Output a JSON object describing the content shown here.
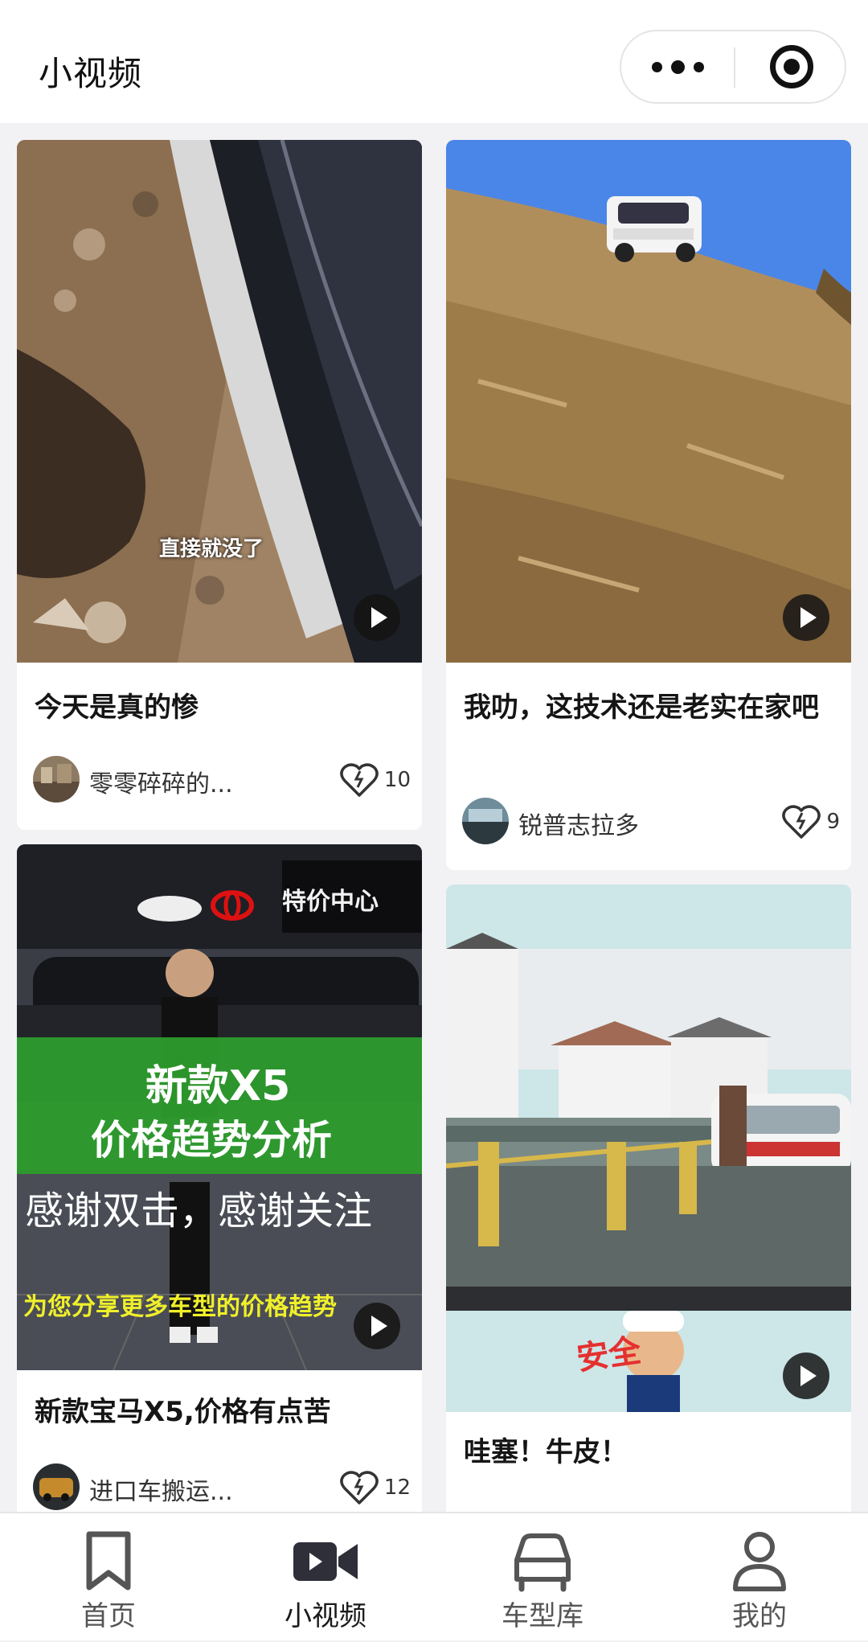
{
  "header": {
    "title": "小视频"
  },
  "colors": {
    "accent": "#2f2f3a",
    "inactive": "#555555"
  },
  "feed": [
    {
      "title": "今天是真的惨",
      "author": "零零碎碎的...",
      "likes": "10",
      "overlay_caption": "直接就没了"
    },
    {
      "title": "我叻，这技术还是老实在家吧",
      "author": "锐普志拉多",
      "likes": "9"
    },
    {
      "title": "新款宝马X5,价格有点苦",
      "author": "进口车搬运...",
      "likes": "12",
      "overlay_sign": "特价中心",
      "overlay_banner_line1": "新款X5",
      "overlay_banner_line2": "价格趋势分析",
      "overlay_line3": "感谢双击，感谢关注",
      "overlay_line4": "为您分享更多车型的价格趋势"
    },
    {
      "title": "哇塞！牛皮！",
      "overlay_sticker": "安全"
    }
  ],
  "tabbar": [
    {
      "label": "首页",
      "icon": "bookmark-icon"
    },
    {
      "label": "小视频",
      "icon": "video-camera-icon",
      "active": true
    },
    {
      "label": "车型库",
      "icon": "car-icon"
    },
    {
      "label": "我的",
      "icon": "user-icon"
    }
  ]
}
